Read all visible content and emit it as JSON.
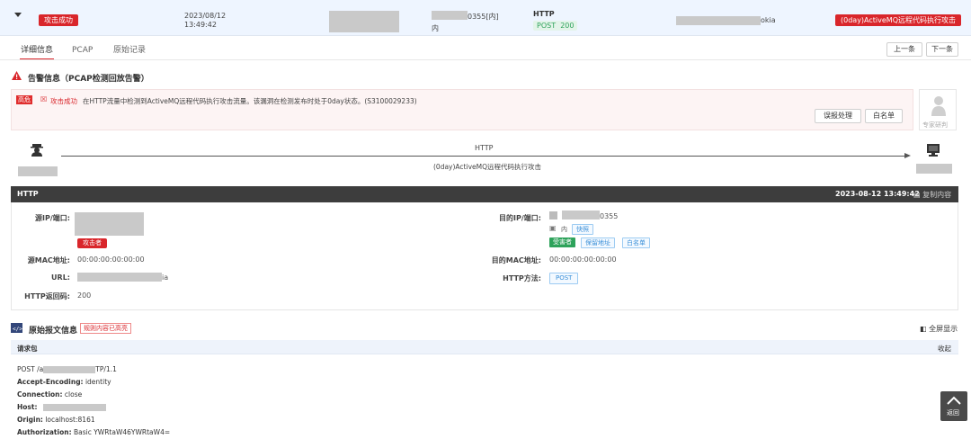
{
  "event_row": {
    "status": "攻击成功",
    "date": "2023/08/12",
    "time": "13:49:42",
    "dst_suffix": "0355[内]",
    "dst_zone": "内",
    "protocol": "HTTP",
    "method": "POST",
    "code": "200",
    "url_suffix": "okia",
    "attack_name": "(0day)ActiveMQ远程代码执行攻击"
  },
  "tabs": [
    "详细信息",
    "PCAP",
    "原始记录"
  ],
  "nav": {
    "prev": "上一条",
    "next": "下一条"
  },
  "alert": {
    "title": "告警信息（PCAP检测回放告警）",
    "level": "高危",
    "result": "攻击成功",
    "message": "在HTTP流量中检测到ActiveMQ远程代码执行攻击流量。该漏洞在检测发布时处于0day状态。(S3100029233)",
    "btn_handle": "误报处理",
    "btn_whitelist": "白名单",
    "expert_label": "专家研判"
  },
  "flow": {
    "protocol": "HTTP",
    "attack": "(0day)ActiveMQ远程代码执行攻击"
  },
  "http_section": {
    "title": "HTTP",
    "timestamp": "2023-08-12 13:49:42",
    "copy_label": "复制内容",
    "src_label": "源IP/端口:",
    "attacker_tag": "攻击者",
    "dst_label": "目的IP/端口:",
    "dst_suffix": "0355",
    "dst_zone": "内",
    "snapshot": "快照",
    "victim_tag": "受害者",
    "reserved_tag": "保留地址",
    "whitelist_tag": "白名单",
    "src_mac_label": "源MAC地址:",
    "src_mac": "00:00:00:00:00:00",
    "dst_mac_label": "目的MAC地址:",
    "dst_mac": "00:00:00:00:00:00",
    "url_label": "URL:",
    "url_suffix": "ia",
    "method_label": "HTTP方法:",
    "method": "POST",
    "code_label": "HTTP返回码:",
    "code": "200"
  },
  "raw": {
    "title": "原始报文信息",
    "badge": "规则内容已高亮",
    "fullscreen": "全屏显示",
    "req_label": "请求包",
    "collapse": "收起",
    "line1_a": "POST /a",
    "line1_b": "TP/1.1",
    "h1_k": "Accept-Encoding:",
    "h1_v": "identity",
    "h2_k": "Connection:",
    "h2_v": "close",
    "h3_k": "Host:",
    "h4_k": "Origin:",
    "h4_v": "localhost:8161",
    "h5_k": "Authorization:",
    "h5_v": "Basic YWRtaW46YWRtaW4="
  },
  "back_label": "返回"
}
